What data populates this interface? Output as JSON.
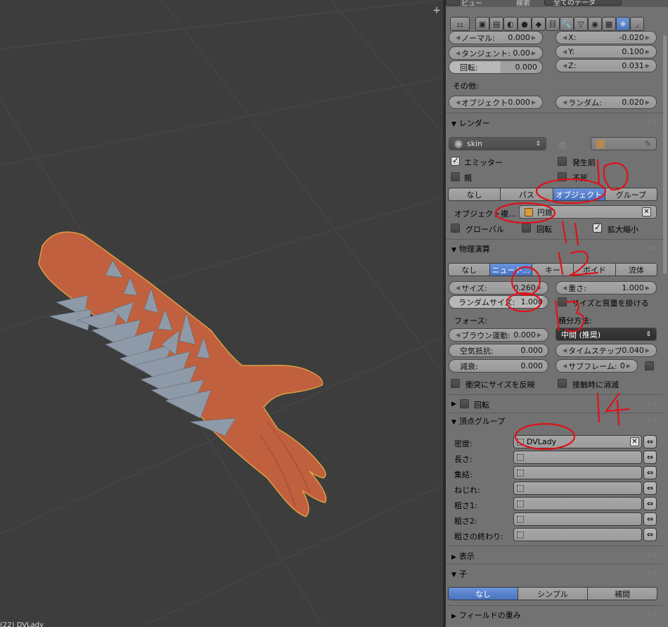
{
  "top_strip": {
    "view_menu": "ビュー",
    "search_label": "検索",
    "filter_value": "全てのデータ"
  },
  "velocity": {
    "normal": {
      "label": "ノーマル:",
      "value": "0.000"
    },
    "tangent": {
      "label": "タンジェント:",
      "value": "0.00"
    },
    "rotation": {
      "label": "回転:",
      "value": "0.000"
    },
    "x": {
      "label": "X:",
      "value": "-0.020"
    },
    "y": {
      "label": "Y:",
      "value": "0.100"
    },
    "z": {
      "label": "Z:",
      "value": "0.031"
    },
    "other_label": "その他:",
    "object": {
      "label": "オブジェクト:",
      "value": "0.000"
    },
    "random": {
      "label": "ランダム:",
      "value": "0.020"
    }
  },
  "render": {
    "header": "レンダー",
    "material": "skin",
    "parent_label": "親:",
    "emitter_label": "エミッター",
    "pre_birth_label": "発生前",
    "parent_cb_label": "親",
    "dead_label": "不死",
    "modes": [
      "なし",
      "パス",
      "オブジェクト",
      "グループ"
    ],
    "selected_mode": "オブジェクト",
    "dupli_label": "オブジェクト複...",
    "dupli_value": "円錐",
    "global_label": "グローバル",
    "rotation_label": "回転",
    "scale_label": "拡大縮小"
  },
  "physics": {
    "header": "物理演算",
    "modes": [
      "なし",
      "ニュート...",
      "キー",
      "ボイド",
      "流体"
    ],
    "selected_mode": "ニュート...",
    "size": {
      "label": "サイズ:",
      "value": "0.260"
    },
    "random_size": {
      "label": "ランダムサイズ:",
      "value": "1.000"
    },
    "mass": {
      "label": "重さ:",
      "value": "1.000"
    },
    "multiply_mass_label": "サイズと質量を掛ける",
    "forces_label": "フォース:",
    "integration_label": "積分方法:",
    "brownian": {
      "label": "ブラウン運動:",
      "value": "0.000"
    },
    "integration_value": "中間 (推奨)",
    "drag": {
      "label": "空気抵抗:",
      "value": "0.000"
    },
    "timestep": {
      "label": "タイムステップ:",
      "value": "0.040"
    },
    "damp": {
      "label": "減衰:",
      "value": "0.000"
    },
    "subframes": {
      "label": "サブフレーム:",
      "value": "0"
    },
    "size_deflect_label": "衝突にサイズを反映",
    "die_on_hit_label": "接触時に消滅"
  },
  "rotation_panel": {
    "header": "回転"
  },
  "vertex_groups": {
    "header": "頂点グループ",
    "rows": [
      {
        "label": "密度:",
        "value": "DVLady"
      },
      {
        "label": "長さ:",
        "value": ""
      },
      {
        "label": "集結:",
        "value": ""
      },
      {
        "label": "ねじれ:",
        "value": ""
      },
      {
        "label": "粗さ1:",
        "value": ""
      },
      {
        "label": "粗さ2:",
        "value": ""
      },
      {
        "label": "粗さの終わり:",
        "value": ""
      }
    ]
  },
  "display_panel": {
    "header": "表示"
  },
  "children": {
    "header": "子",
    "modes": [
      "なし",
      "シンプル",
      "補間"
    ],
    "selected_mode": "なし"
  },
  "field_weights": {
    "header": "フィールドの重み"
  },
  "annotations": [
    "10",
    "11",
    "12",
    "13",
    "14"
  ],
  "viewport_label": "(22) DVLady",
  "colors": {
    "accent": "#5680c8",
    "skin": "#c0603e",
    "spikes": "#8e9aa8",
    "annotation": "#e0101a"
  }
}
